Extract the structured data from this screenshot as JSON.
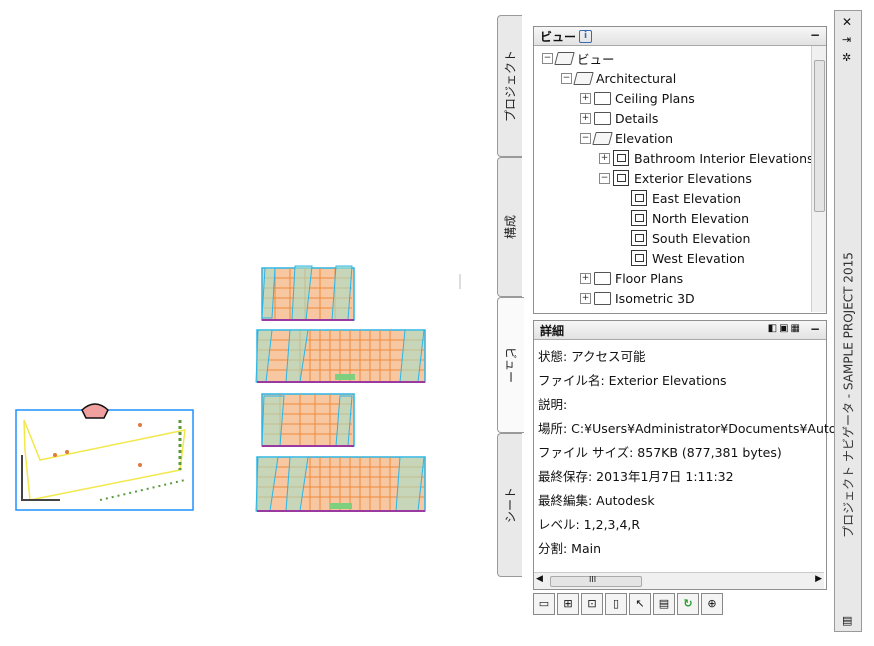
{
  "palette": {
    "title": "プロジェクト ナビゲータ - SAMPLE PROJECT 2015",
    "tabs": [
      "プロジェクト",
      "構成",
      "ビュー",
      "シート"
    ],
    "views_panel": {
      "title": "ビュー",
      "minimize": "−",
      "tree": [
        {
          "label": "ビュー",
          "level": 0,
          "icon": "open-folder-icon",
          "expander": "−"
        },
        {
          "label": "Architectural",
          "level": 1,
          "icon": "open-folder-icon",
          "expander": "−"
        },
        {
          "label": "Ceiling Plans",
          "level": 2,
          "icon": "folder-icon",
          "expander": "+"
        },
        {
          "label": "Details",
          "level": 2,
          "icon": "folder-icon",
          "expander": "+"
        },
        {
          "label": "Elevation",
          "level": 2,
          "icon": "open-folder-icon",
          "expander": "−"
        },
        {
          "label": "Bathroom Interior Elevations",
          "level": 3,
          "icon": "view-icon",
          "expander": "+"
        },
        {
          "label": "Exterior Elevations",
          "level": 3,
          "icon": "view-icon",
          "expander": "−"
        },
        {
          "label": "East Elevation",
          "level": 4,
          "icon": "view-icon",
          "expander": ""
        },
        {
          "label": "North Elevation",
          "level": 4,
          "icon": "view-icon",
          "expander": ""
        },
        {
          "label": "South Elevation",
          "level": 4,
          "icon": "view-icon",
          "expander": ""
        },
        {
          "label": "West Elevation",
          "level": 4,
          "icon": "view-icon",
          "expander": ""
        },
        {
          "label": "Floor Plans",
          "level": 2,
          "icon": "folder-icon",
          "expander": "+"
        },
        {
          "label": "Isometric 3D",
          "level": 2,
          "icon": "folder-icon",
          "expander": "+"
        }
      ]
    },
    "details_panel": {
      "title": "詳細",
      "minimize": "−",
      "rows": [
        "状態: アクセス可能",
        "ファイル名: Exterior Elevations",
        "説明:",
        "場所: C:¥Users¥Administrator¥Documents¥Autoc",
        "ファイル サイズ: 857KB (877,381 bytes)",
        "最終保存: 2013年1月7日  1:11:32",
        "最終編集: Autodesk",
        "レベル: 1,2,3,4,R",
        "分割: Main"
      ],
      "scroll_grip": "III"
    },
    "toolbar_buttons": [
      "new-view-icon",
      "new-section-icon",
      "new-detail-icon",
      "clipboard-icon",
      "properties-icon",
      "sheet-icon",
      "refresh-icon",
      "regenerate-icon"
    ]
  },
  "colors": {
    "building_fill": "#f08a3c",
    "viewport_outline": "#2bb5e6",
    "plan_outline": "#1e90ff",
    "accent_green": "#2a9a2a"
  }
}
